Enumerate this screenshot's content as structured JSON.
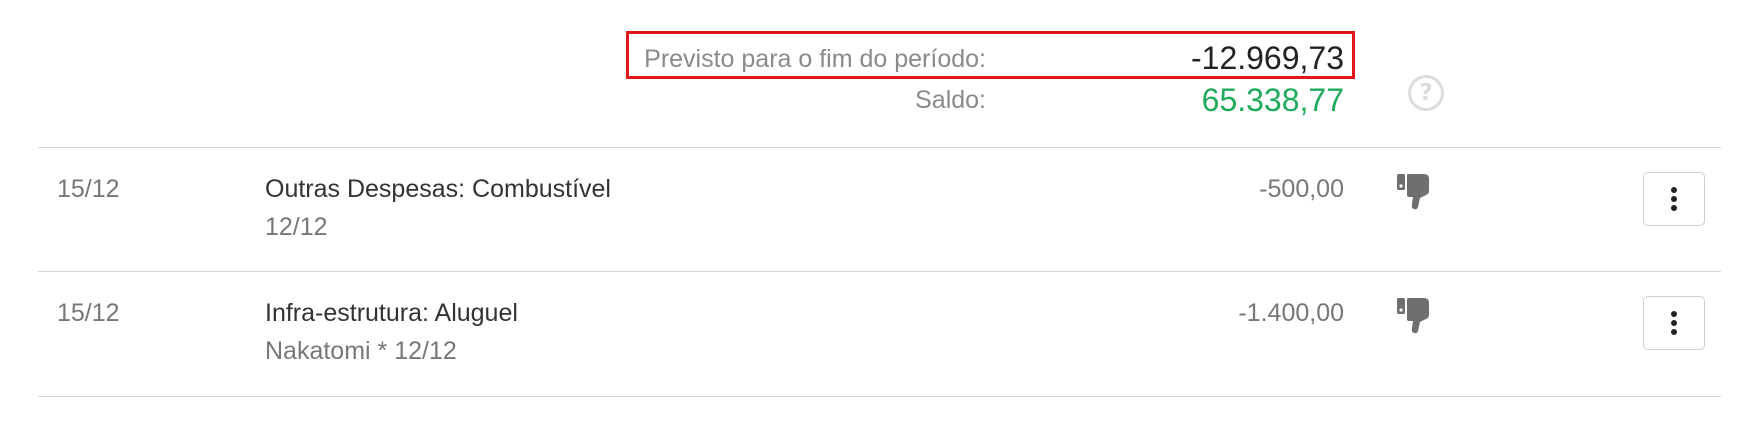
{
  "summary": {
    "forecast_label": "Previsto para o fim do período:",
    "forecast_value": "-12.969,73",
    "balance_label": "Saldo:",
    "balance_value": "65.338,77",
    "balance_color": "#1faa5c",
    "highlight_color": "#e0161b",
    "help_icon": "question-circle-icon",
    "help_symbol": "?"
  },
  "transactions": [
    {
      "date": "15/12",
      "title": "Outras Despesas: Combustível",
      "subtitle": "12/12",
      "amount": "-500,00",
      "status_icon": "thumbs-down-icon",
      "menu_icon": "vertical-ellipsis-icon"
    },
    {
      "date": "15/12",
      "title": "Infra-estrutura: Aluguel",
      "subtitle": "Nakatomi * 12/12",
      "amount": "-1.400,00",
      "status_icon": "thumbs-down-icon",
      "menu_icon": "vertical-ellipsis-icon"
    }
  ]
}
